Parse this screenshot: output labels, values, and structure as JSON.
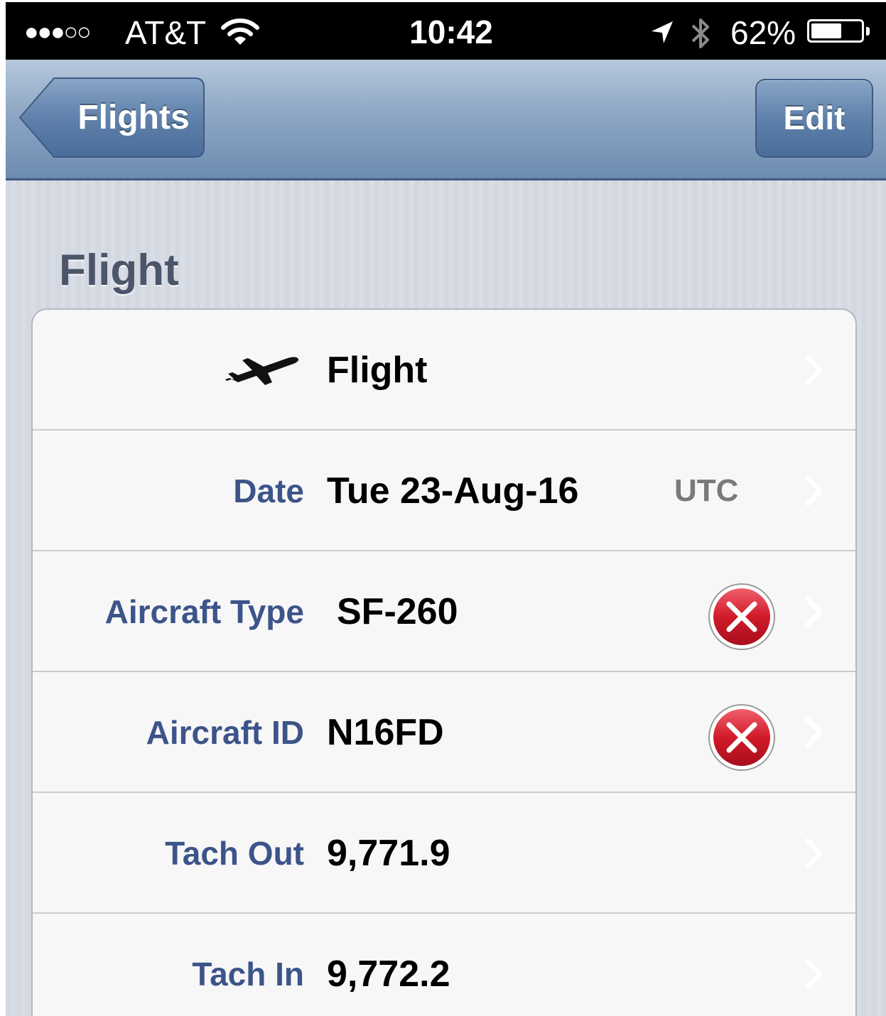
{
  "status_bar": {
    "signal": "●●●○○",
    "carrier": "AT&T",
    "time": "10:42",
    "battery_percent": "62%",
    "battery_level": 0.62,
    "icons": [
      "wifi-icon",
      "location-arrow-icon",
      "bluetooth-icon",
      "battery-icon"
    ]
  },
  "navbar": {
    "back_label": "Flights",
    "edit_label": "Edit"
  },
  "section": {
    "title": "Flight"
  },
  "rows": [
    {
      "label": "",
      "value": "Flight",
      "icon": "airplane-icon"
    },
    {
      "label": "Date",
      "value": "Tue 23-Aug-16",
      "hint": "UTC"
    },
    {
      "label": "Aircraft Type",
      "value": "SF-260",
      "clear_icon": "clear-x-icon"
    },
    {
      "label": "Aircraft ID",
      "value": "N16FD",
      "clear_icon": "clear-x-icon"
    },
    {
      "label": "Tach Out",
      "value": "9,771.9"
    },
    {
      "label": "Tach In",
      "value": "9,772.2"
    }
  ],
  "colors": {
    "label_blue": "#3c5489",
    "nav_blue": "#6d8cb2",
    "clear_red": "#d11a2a"
  }
}
